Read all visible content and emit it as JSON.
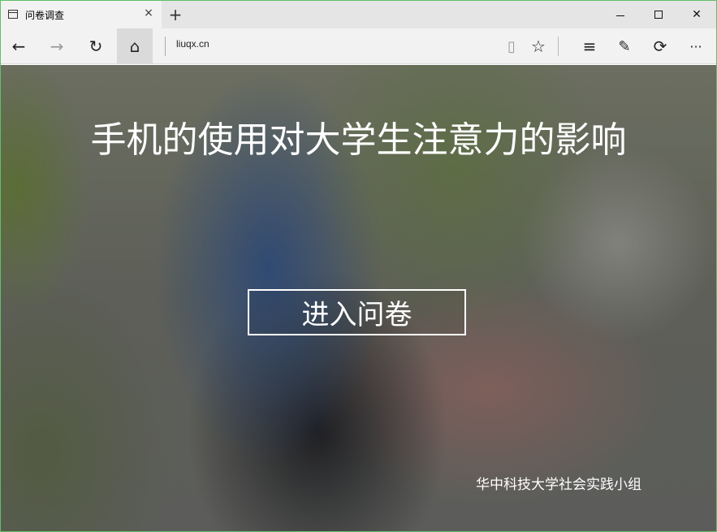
{
  "tab": {
    "title": "问卷调查",
    "close_glyph": "×"
  },
  "new_tab_glyph": "+",
  "toolbar": {
    "back_glyph": "←",
    "forward_glyph": "→",
    "refresh_glyph": "↻",
    "home_glyph": "⌂",
    "address": "liuqx.cn",
    "reading_glyph": "▯",
    "favorite_glyph": "☆",
    "hub_glyph": "≡",
    "note_glyph": "✎",
    "share_glyph": "⟳",
    "more_glyph": "···"
  },
  "window": {
    "close_glyph": "✕"
  },
  "page": {
    "headline": "手机的使用对大学生注意力的影响",
    "enter_button": "进入问卷",
    "credit": "华中科技大学社会实践小组"
  }
}
